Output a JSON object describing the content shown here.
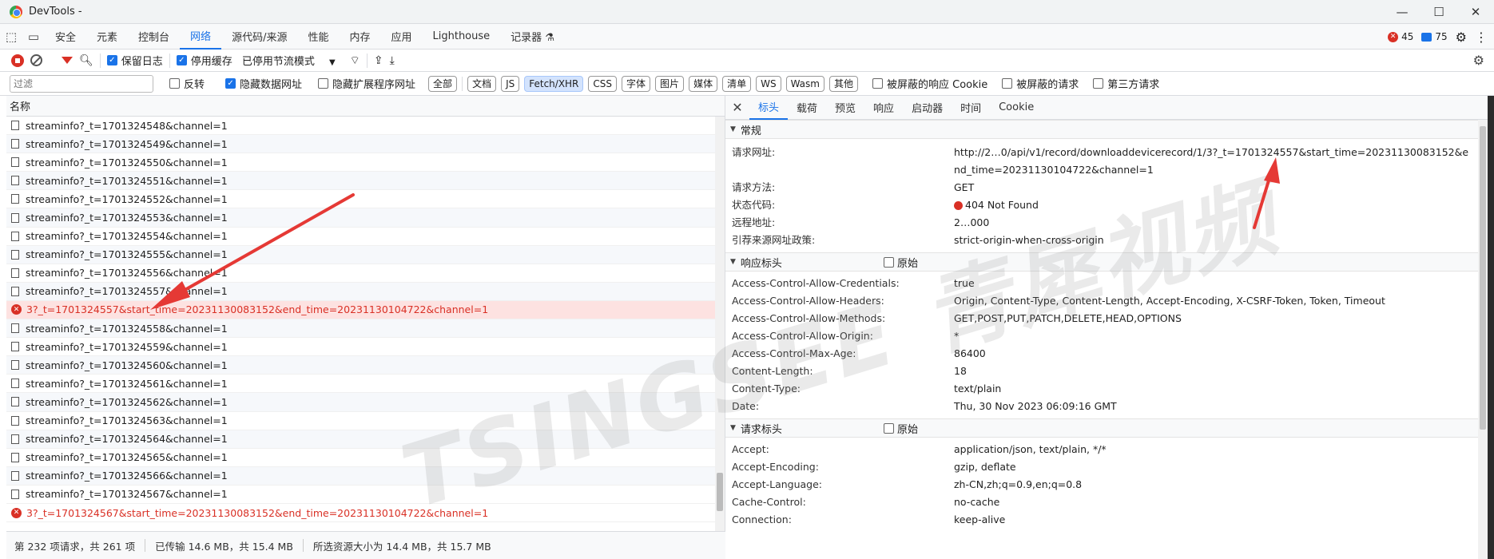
{
  "window": {
    "title": "DevTools - ",
    "controls": [
      "—",
      "☐",
      "✕"
    ]
  },
  "panel_tabs": [
    "安全",
    "元素",
    "控制台",
    "网络",
    "源代码/来源",
    "性能",
    "内存",
    "应用",
    "Lighthouse",
    "记录器 ⚗"
  ],
  "active_panel": "网络",
  "badges": {
    "errors": "45",
    "messages": "75"
  },
  "toolbar": {
    "preserve_log": "保留日志",
    "disable_cache": "停用缓存",
    "throttle": "已停用节流模式"
  },
  "filter_bar": {
    "placeholder": "过滤",
    "invert": "反转",
    "hide_data_urls": "隐藏数据网址",
    "hide_ext_urls": "隐藏扩展程序网址",
    "types": [
      "全部",
      "文档",
      "JS",
      "Fetch/XHR",
      "CSS",
      "字体",
      "图片",
      "媒体",
      "清单",
      "WS",
      "Wasm",
      "其他"
    ],
    "active_type": "Fetch/XHR",
    "blocked_cookies": "被屏蔽的响应 Cookie",
    "blocked_requests": "被屏蔽的请求",
    "third_party": "第三方请求"
  },
  "request_list": {
    "header": "名称",
    "rows": [
      {
        "name": "streaminfo?_t=1701324548&channel=1",
        "error": false
      },
      {
        "name": "streaminfo?_t=1701324549&channel=1",
        "error": false
      },
      {
        "name": "streaminfo?_t=1701324550&channel=1",
        "error": false
      },
      {
        "name": "streaminfo?_t=1701324551&channel=1",
        "error": false
      },
      {
        "name": "streaminfo?_t=1701324552&channel=1",
        "error": false
      },
      {
        "name": "streaminfo?_t=1701324553&channel=1",
        "error": false
      },
      {
        "name": "streaminfo?_t=1701324554&channel=1",
        "error": false
      },
      {
        "name": "streaminfo?_t=1701324555&channel=1",
        "error": false
      },
      {
        "name": "streaminfo?_t=1701324556&channel=1",
        "error": false
      },
      {
        "name": "streaminfo?_t=1701324557&channel=1",
        "error": false
      },
      {
        "name": "3?_t=1701324557&start_time=20231130083152&end_time=20231130104722&channel=1",
        "error": true,
        "selected": true
      },
      {
        "name": "streaminfo?_t=1701324558&channel=1",
        "error": false
      },
      {
        "name": "streaminfo?_t=1701324559&channel=1",
        "error": false
      },
      {
        "name": "streaminfo?_t=1701324560&channel=1",
        "error": false
      },
      {
        "name": "streaminfo?_t=1701324561&channel=1",
        "error": false
      },
      {
        "name": "streaminfo?_t=1701324562&channel=1",
        "error": false
      },
      {
        "name": "streaminfo?_t=1701324563&channel=1",
        "error": false
      },
      {
        "name": "streaminfo?_t=1701324564&channel=1",
        "error": false
      },
      {
        "name": "streaminfo?_t=1701324565&channel=1",
        "error": false
      },
      {
        "name": "streaminfo?_t=1701324566&channel=1",
        "error": false
      },
      {
        "name": "streaminfo?_t=1701324567&channel=1",
        "error": false
      },
      {
        "name": "3?_t=1701324567&start_time=20231130083152&end_time=20231130104722&channel=1",
        "error": true,
        "selected": false
      }
    ]
  },
  "status_bar": {
    "requests": "第 232 项请求，共 261 项",
    "transferred": "已传输 14.6 MB，共 15.4 MB",
    "resources": "所选资源大小为 14.4 MB，共 15.7 MB"
  },
  "detail_tabs": [
    "标头",
    "载荷",
    "预览",
    "响应",
    "启动器",
    "时间",
    "Cookie"
  ],
  "active_detail_tab": "标头",
  "general": {
    "title": "常规",
    "rows": [
      {
        "k": "请求网址:",
        "v": "http://2…0/api/v1/record/downloaddevicerecord/1/3?_t=1701324557&start_time=20231130083152&end_time=20231130104722&channel=1"
      },
      {
        "k": "请求方法:",
        "v": "GET"
      },
      {
        "k": "状态代码:",
        "v": "404 Not Found",
        "status": true
      },
      {
        "k": "远程地址:",
        "v": "2…000"
      },
      {
        "k": "引荐来源网址政策:",
        "v": "strict-origin-when-cross-origin"
      }
    ]
  },
  "response_headers": {
    "title": "响应标头",
    "raw": "原始",
    "rows": [
      {
        "k": "Access-Control-Allow-Credentials:",
        "v": "true"
      },
      {
        "k": "Access-Control-Allow-Headers:",
        "v": "Origin, Content-Type, Content-Length, Accept-Encoding, X-CSRF-Token, Token, Timeout"
      },
      {
        "k": "Access-Control-Allow-Methods:",
        "v": "GET,POST,PUT,PATCH,DELETE,HEAD,OPTIONS"
      },
      {
        "k": "Access-Control-Allow-Origin:",
        "v": "*"
      },
      {
        "k": "Access-Control-Max-Age:",
        "v": "86400"
      },
      {
        "k": "Content-Length:",
        "v": "18"
      },
      {
        "k": "Content-Type:",
        "v": "text/plain"
      },
      {
        "k": "Date:",
        "v": "Thu, 30 Nov 2023 06:09:16 GMT"
      }
    ]
  },
  "request_headers": {
    "title": "请求标头",
    "raw": "原始",
    "rows": [
      {
        "k": "Accept:",
        "v": "application/json, text/plain, */*"
      },
      {
        "k": "Accept-Encoding:",
        "v": "gzip, deflate"
      },
      {
        "k": "Accept-Language:",
        "v": "zh-CN,zh;q=0.9,en;q=0.8"
      },
      {
        "k": "Cache-Control:",
        "v": "no-cache"
      },
      {
        "k": "Connection:",
        "v": "keep-alive"
      }
    ]
  },
  "watermark": "TSINGSEE 青犀视频",
  "colors": {
    "accent": "#1a73e8",
    "error": "#d93025",
    "arrow": "#e53935"
  }
}
